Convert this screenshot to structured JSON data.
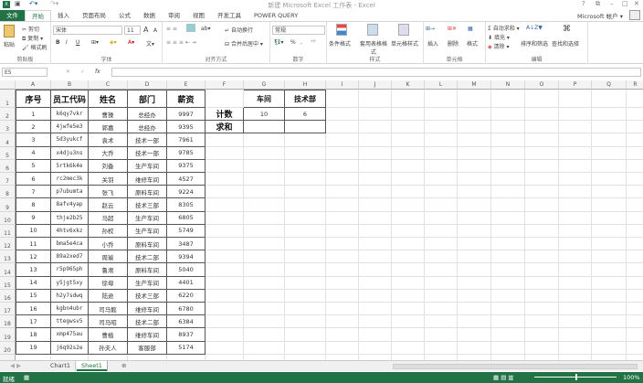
{
  "title": "新建 Microsoft Excel 工作表 - Excel",
  "window_controls": [
    "?",
    "⧉",
    "–",
    "□",
    "✕"
  ],
  "tabs": [
    "文件",
    "开始",
    "插入",
    "页面布局",
    "公式",
    "数据",
    "审阅",
    "视图",
    "开发工具",
    "POWER QUERY"
  ],
  "account": "Microsoft 帐户 ▾",
  "ribbon": {
    "clipboard": {
      "paste": "粘贴",
      "cut": "剪切",
      "copy": "复制 ▾",
      "format_painter": "格式刷",
      "label": "剪贴板"
    },
    "font": {
      "name": "宋体",
      "size": "11",
      "grow": "A",
      "shrink": "A",
      "bold": "B",
      "italic": "I",
      "underline": "U",
      "label": "字体"
    },
    "alignment": {
      "wrap": "自动换行",
      "merge": "合并后居中",
      "label": "对齐方式"
    },
    "number": {
      "format": "常规",
      "percent": "%",
      "comma": ",",
      "label": "数字"
    },
    "styles": {
      "conditional": "条件格式",
      "table": "套用表格格式",
      "cell_styles": "单元格样式",
      "label": "样式"
    },
    "cells": {
      "insert": "插入",
      "delete": "删除",
      "format": "格式",
      "label": "单元格"
    },
    "editing": {
      "autosum": "自动求和",
      "fill": "填充",
      "clear": "清除",
      "sort": "排序和筛选",
      "find": "查找和选择",
      "label": "编辑"
    }
  },
  "formula_bar": {
    "name_box": "E5",
    "cancel": "✕",
    "enter": "✓",
    "fx": "fx",
    "value": ""
  },
  "columns": [
    "A",
    "B",
    "C",
    "D",
    "E",
    "F",
    "G",
    "H",
    "I",
    "J",
    "K",
    "L",
    "M",
    "N",
    "O",
    "P",
    "Q",
    "R"
  ],
  "table": {
    "headers": [
      "序号",
      "员工代码",
      "姓名",
      "部门",
      "薪资"
    ],
    "rows": [
      [
        "1",
        "k6qy7vkr",
        "曹操",
        "总经办",
        "9997"
      ],
      [
        "2",
        "4jwfe5e3",
        "郭嘉",
        "总经办",
        "9395"
      ],
      [
        "3",
        "5d3yukcf",
        "袁术",
        "技术一部",
        "7961"
      ],
      [
        "4",
        "x4dju3ns",
        "大乔",
        "技术一部",
        "9785"
      ],
      [
        "5",
        "5rtk6k4e",
        "刘备",
        "生产车间",
        "9375"
      ],
      [
        "6",
        "rc2mec3k",
        "关羽",
        "维修车间",
        "4527"
      ],
      [
        "7",
        "p7ubumta",
        "张飞",
        "原料车间",
        "9224"
      ],
      [
        "8",
        "8afv4yap",
        "赵云",
        "技术三部",
        "8305"
      ],
      [
        "9",
        "thje2b25",
        "马超",
        "生产车间",
        "6805"
      ],
      [
        "10",
        "4htv6xkz",
        "孙权",
        "生产车间",
        "5749"
      ],
      [
        "11",
        "bma5e4ca",
        "小乔",
        "原料车间",
        "3487"
      ],
      [
        "12",
        "89a2xed7",
        "周瑜",
        "技术二部",
        "9394"
      ],
      [
        "13",
        "r5p965ph",
        "鲁肃",
        "原料车间",
        "5040"
      ],
      [
        "14",
        "y5jgt5xy",
        "徐母",
        "生产车间",
        "4401"
      ],
      [
        "15",
        "h2y7sdwq",
        "陆逊",
        "技术三部",
        "6220"
      ],
      [
        "16",
        "kgbn4ubr",
        "司马懿",
        "维修车间",
        "6780"
      ],
      [
        "17",
        "ttegwsv5",
        "司马昭",
        "技术二部",
        "6384"
      ],
      [
        "18",
        "xmp475au",
        "曹植",
        "维修车间",
        "8937"
      ],
      [
        "19",
        "j6q92s2e",
        "孙夫人",
        "客服部",
        "5174"
      ]
    ]
  },
  "summary": {
    "col_g": "车间",
    "col_h": "技术部",
    "row_count": "计数",
    "row_sum": "求和",
    "count_g": "10",
    "count_h": "6"
  },
  "sheets": [
    "Chart1",
    "Sheet1"
  ],
  "active_sheet": "Sheet1",
  "status": {
    "ready": "就绪",
    "zoom": "100%"
  },
  "colors": {
    "excel_green": "#217346"
  }
}
